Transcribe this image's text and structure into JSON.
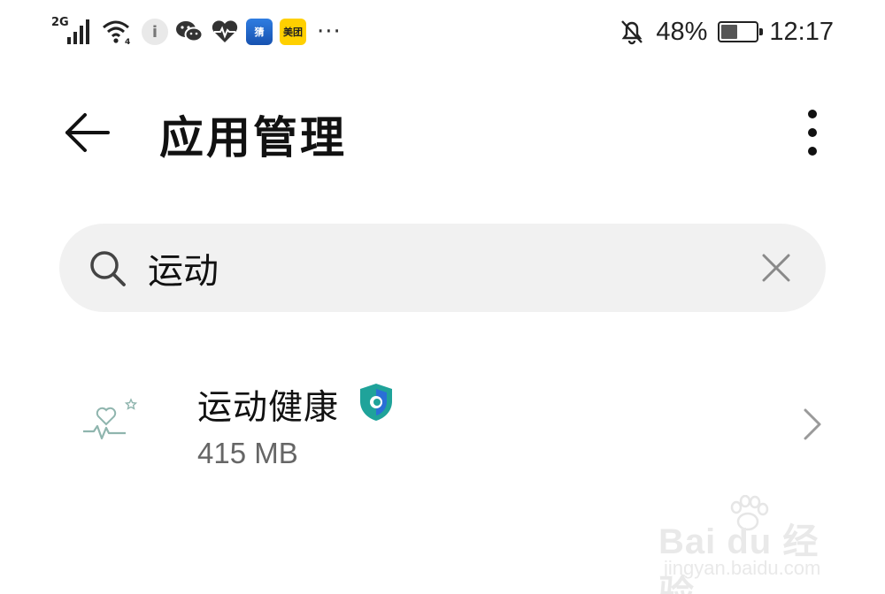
{
  "status_bar": {
    "network_type": "2G",
    "more_indicator": "···",
    "meituan_label": "美团",
    "news_app_label": "猜",
    "battery_percent": "48%",
    "battery_level": 0.48,
    "time": "12:17",
    "icons": [
      "signal-icon",
      "wifi-icon",
      "info-app-icon",
      "wechat-icon",
      "health-icon",
      "news-app-icon",
      "meituan-icon",
      "mute-bell-icon",
      "battery-icon"
    ]
  },
  "header": {
    "title": "应用管理"
  },
  "search": {
    "value": "运动"
  },
  "app_list": [
    {
      "name": "运动健康",
      "size": "415 MB",
      "icon": "health-heartbeat-icon",
      "badge": "verified-shield-icon"
    }
  ],
  "watermark": {
    "main": "Bai  du 经验",
    "sub": "jingyan.baidu.com"
  },
  "colors": {
    "background": "#ffffff",
    "search_background": "#f1f1f1",
    "badge_teal": "#1fa39a",
    "badge_blue": "#2a6fd6",
    "secondary_text": "#666666"
  }
}
